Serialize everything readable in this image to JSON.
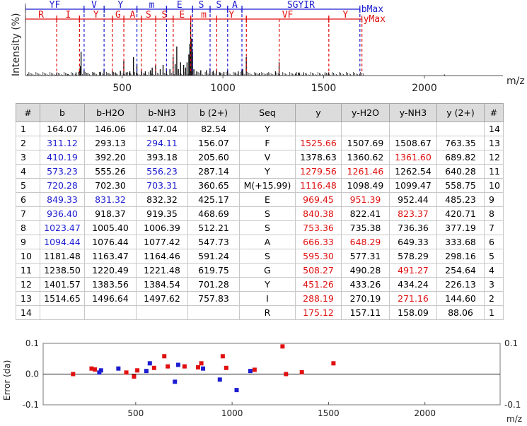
{
  "chart_data": [
    {
      "type": "bar",
      "ylabel": "Intensity (%)",
      "xlabel": "m/z",
      "xlim": [
        20,
        2390
      ],
      "xticks": [
        "500",
        "1000",
        "1500",
        "2000"
      ],
      "b_ion_ladder": {
        "end_label": "bMax",
        "color": "#1c1cd0",
        "segments": [
          {
            "label": "YF",
            "start": 20,
            "end": 311.12
          },
          {
            "label": "V",
            "start": 311.12,
            "end": 410.19
          },
          {
            "label": "Y",
            "start": 410.19,
            "end": 573.23
          },
          {
            "label": "m",
            "start": 573.23,
            "end": 720.28
          },
          {
            "label": "E",
            "start": 720.28,
            "end": 849.33
          },
          {
            "label": "S",
            "start": 849.33,
            "end": 936.4
          },
          {
            "label": "S",
            "start": 936.4,
            "end": 1023.47
          },
          {
            "label": "A",
            "start": 1023.47,
            "end": 1094.44
          },
          {
            "label": "SGYIR",
            "start": 1094.44,
            "end": 1680
          }
        ],
        "dashed_positions": [
          311.12,
          410.19,
          573.23,
          720.28,
          849.33,
          936.4,
          1023.47,
          1094.44,
          1680
        ]
      },
      "y_ion_ladder": {
        "end_label": "yMax",
        "color": "#e01010",
        "segments": [
          {
            "label": "R",
            "start": 20,
            "end": 175.12
          },
          {
            "label": "I",
            "start": 175.12,
            "end": 288.19
          },
          {
            "label": "Y",
            "start": 288.19,
            "end": 451.26
          },
          {
            "label": "G",
            "start": 451.26,
            "end": 508.27
          },
          {
            "label": "A",
            "start": 508.27,
            "end": 595.3
          },
          {
            "label": "S",
            "start": 595.3,
            "end": 666.33
          },
          {
            "label": "S",
            "start": 666.33,
            "end": 753.36
          },
          {
            "label": "E",
            "start": 753.36,
            "end": 840.38
          },
          {
            "label": "m",
            "start": 840.38,
            "end": 969.45
          },
          {
            "label": "Y",
            "start": 969.45,
            "end": 1116.48
          },
          {
            "label": "VF",
            "start": 1116.48,
            "end": 1525.66
          },
          {
            "label": "Y",
            "start": 1525.66,
            "end": 1690
          }
        ],
        "dashed_positions": [
          175.12,
          288.19,
          451.26,
          508.27,
          595.3,
          666.33,
          753.36,
          840.38,
          969.45,
          1116.48,
          1279.56,
          1525.66,
          1690
        ]
      },
      "peaks": [
        {
          "mz": 30,
          "i": 3
        },
        {
          "mz": 175,
          "i": 5
        },
        {
          "mz": 230,
          "i": 3
        },
        {
          "mz": 271,
          "i": 6
        },
        {
          "mz": 288,
          "i": 10
        },
        {
          "mz": 292,
          "i": 18
        },
        {
          "mz": 296,
          "i": 45
        },
        {
          "mz": 311,
          "i": 10
        },
        {
          "mz": 330,
          "i": 5
        },
        {
          "mz": 360,
          "i": 6
        },
        {
          "mz": 392,
          "i": 7
        },
        {
          "mz": 410,
          "i": 12
        },
        {
          "mz": 430,
          "i": 5
        },
        {
          "mz": 451,
          "i": 8
        },
        {
          "mz": 466,
          "i": 6
        },
        {
          "mz": 491,
          "i": 9
        },
        {
          "mz": 508,
          "i": 28
        },
        {
          "mz": 520,
          "i": 6
        },
        {
          "mz": 538,
          "i": 8
        },
        {
          "mz": 556,
          "i": 35
        },
        {
          "mz": 573,
          "i": 22
        },
        {
          "mz": 595,
          "i": 12
        },
        {
          "mz": 615,
          "i": 8
        },
        {
          "mz": 640,
          "i": 10
        },
        {
          "mz": 649,
          "i": 15
        },
        {
          "mz": 666,
          "i": 20
        },
        {
          "mz": 689,
          "i": 12
        },
        {
          "mz": 703,
          "i": 20
        },
        {
          "mz": 720,
          "i": 14
        },
        {
          "mz": 737,
          "i": 12
        },
        {
          "mz": 753,
          "i": 35
        },
        {
          "mz": 763,
          "i": 22
        },
        {
          "mz": 771,
          "i": 55
        },
        {
          "mz": 779,
          "i": 12
        },
        {
          "mz": 790,
          "i": 25
        },
        {
          "mz": 805,
          "i": 20
        },
        {
          "mz": 815,
          "i": 15
        },
        {
          "mz": 822,
          "i": 25
        },
        {
          "mz": 831,
          "i": 40
        },
        {
          "mz": 836,
          "i": 60
        },
        {
          "mz": 840,
          "i": 100
        },
        {
          "mz": 845,
          "i": 70
        },
        {
          "mz": 849,
          "i": 45
        },
        {
          "mz": 856,
          "i": 12
        },
        {
          "mz": 870,
          "i": 8
        },
        {
          "mz": 890,
          "i": 10
        },
        {
          "mz": 918,
          "i": 10
        },
        {
          "mz": 936,
          "i": 14
        },
        {
          "mz": 952,
          "i": 9
        },
        {
          "mz": 969,
          "i": 12
        },
        {
          "mz": 985,
          "i": 6
        },
        {
          "mz": 1005,
          "i": 7
        },
        {
          "mz": 1023,
          "i": 10
        },
        {
          "mz": 1060,
          "i": 6
        },
        {
          "mz": 1076,
          "i": 8
        },
        {
          "mz": 1094,
          "i": 10
        },
        {
          "mz": 1098,
          "i": 12
        },
        {
          "mz": 1116,
          "i": 35
        },
        {
          "mz": 1163,
          "i": 4
        },
        {
          "mz": 1181,
          "i": 5
        },
        {
          "mz": 1220,
          "i": 5
        },
        {
          "mz": 1261,
          "i": 8
        },
        {
          "mz": 1279,
          "i": 25
        },
        {
          "mz": 1360,
          "i": 4
        },
        {
          "mz": 1378,
          "i": 6
        },
        {
          "mz": 1401,
          "i": 4
        },
        {
          "mz": 1507,
          "i": 4
        },
        {
          "mz": 1525,
          "i": 6
        },
        {
          "mz": 1680,
          "i": 3
        },
        {
          "mz": 2100,
          "i": 2
        }
      ]
    },
    {
      "type": "scatter",
      "ylabel": "Error (da)",
      "xlabel": "m/z",
      "ylim": [
        -0.1,
        0.1
      ],
      "xlim": [
        20,
        2390
      ],
      "yticks_left": [
        "0.1",
        "0.0",
        "-0.1"
      ],
      "yticks_right": [
        "0.1",
        "-0.1"
      ],
      "xticks": [
        "500",
        "1000",
        "1500",
        "2000"
      ],
      "series": [
        {
          "color": "#1c1cd0",
          "points": [
            {
              "x": 311.12,
              "y": 0.005
            },
            {
              "x": 320,
              "y": 0.012
            },
            {
              "x": 410.19,
              "y": 0.018
            },
            {
              "x": 555.26,
              "y": 0.01
            },
            {
              "x": 573.23,
              "y": 0.035
            },
            {
              "x": 703.31,
              "y": -0.025
            },
            {
              "x": 720.28,
              "y": 0.03
            },
            {
              "x": 849.33,
              "y": 0.018
            },
            {
              "x": 936.4,
              "y": -0.018
            },
            {
              "x": 1023.47,
              "y": -0.052
            },
            {
              "x": 1094.44,
              "y": 0.01
            }
          ]
        },
        {
          "color": "#e01010",
          "points": [
            {
              "x": 175.12,
              "y": 0.0
            },
            {
              "x": 271.16,
              "y": 0.018
            },
            {
              "x": 288.19,
              "y": 0.015
            },
            {
              "x": 451.26,
              "y": 0.005
            },
            {
              "x": 491.27,
              "y": -0.008
            },
            {
              "x": 508.27,
              "y": 0.012
            },
            {
              "x": 595.3,
              "y": 0.02
            },
            {
              "x": 648.29,
              "y": 0.058
            },
            {
              "x": 666.33,
              "y": 0.025
            },
            {
              "x": 753.36,
              "y": 0.025
            },
            {
              "x": 823.37,
              "y": 0.022
            },
            {
              "x": 840.38,
              "y": 0.035
            },
            {
              "x": 951.39,
              "y": 0.058
            },
            {
              "x": 969.45,
              "y": 0.02
            },
            {
              "x": 1116.48,
              "y": 0.014
            },
            {
              "x": 1261.46,
              "y": 0.09
            },
            {
              "x": 1279.56,
              "y": 0.0
            },
            {
              "x": 1361.6,
              "y": 0.006
            },
            {
              "x": 1525.66,
              "y": 0.035
            }
          ]
        }
      ]
    }
  ],
  "table": {
    "headers": [
      "#",
      "b",
      "b-H2O",
      "b-NH3",
      "b (2+)",
      "Seq",
      "y",
      "y-H2O",
      "y-NH3",
      "y (2+)",
      "#"
    ],
    "colors": {
      "blue": "#1c1cd0",
      "red": "#e01010"
    },
    "rows": [
      {
        "i": "1",
        "b": "164.07",
        "bh": "146.06",
        "bn": "147.04",
        "b2": "82.54",
        "seq": "Y",
        "y": "",
        "yh": "",
        "yn": "",
        "y2": "",
        "j": "14",
        "hl": []
      },
      {
        "i": "2",
        "b": "311.12",
        "bh": "293.13",
        "bn": "294.11",
        "b2": "156.07",
        "seq": "F",
        "y": "1525.66",
        "yh": "1507.69",
        "yn": "1508.67",
        "y2": "763.35",
        "j": "13",
        "hl": [
          "b",
          "bn",
          "y"
        ]
      },
      {
        "i": "3",
        "b": "410.19",
        "bh": "392.20",
        "bn": "393.18",
        "b2": "205.60",
        "seq": "V",
        "y": "1378.63",
        "yh": "1360.62",
        "yn": "1361.60",
        "y2": "689.82",
        "j": "12",
        "hl": [
          "b",
          "yn"
        ]
      },
      {
        "i": "4",
        "b": "573.23",
        "bh": "555.26",
        "bn": "556.23",
        "b2": "287.14",
        "seq": "Y",
        "y": "1279.56",
        "yh": "1261.46",
        "yn": "1262.54",
        "y2": "640.28",
        "j": "11",
        "hl": [
          "b",
          "bn",
          "y",
          "yh"
        ]
      },
      {
        "i": "5",
        "b": "720.28",
        "bh": "702.30",
        "bn": "703.31",
        "b2": "360.65",
        "seq": "M(+15.99)",
        "y": "1116.48",
        "yh": "1098.49",
        "yn": "1099.47",
        "y2": "558.75",
        "j": "10",
        "hl": [
          "b",
          "bn",
          "y"
        ]
      },
      {
        "i": "6",
        "b": "849.33",
        "bh": "831.32",
        "bn": "832.32",
        "b2": "425.17",
        "seq": "E",
        "y": "969.45",
        "yh": "951.39",
        "yn": "952.44",
        "y2": "485.23",
        "j": "9",
        "hl": [
          "b",
          "bh",
          "y",
          "yh"
        ]
      },
      {
        "i": "7",
        "b": "936.40",
        "bh": "918.37",
        "bn": "919.35",
        "b2": "468.69",
        "seq": "S",
        "y": "840.38",
        "yh": "822.41",
        "yn": "823.37",
        "y2": "420.71",
        "j": "8",
        "hl": [
          "b",
          "y",
          "yn"
        ]
      },
      {
        "i": "8",
        "b": "1023.47",
        "bh": "1005.40",
        "bn": "1006.39",
        "b2": "512.21",
        "seq": "S",
        "y": "753.36",
        "yh": "735.38",
        "yn": "736.36",
        "y2": "377.19",
        "j": "7",
        "hl": [
          "b",
          "y"
        ]
      },
      {
        "i": "9",
        "b": "1094.44",
        "bh": "1076.44",
        "bn": "1077.42",
        "b2": "547.73",
        "seq": "A",
        "y": "666.33",
        "yh": "648.29",
        "yn": "649.33",
        "y2": "333.68",
        "j": "6",
        "hl": [
          "b",
          "y",
          "yh"
        ]
      },
      {
        "i": "10",
        "b": "1181.48",
        "bh": "1163.47",
        "bn": "1164.46",
        "b2": "591.24",
        "seq": "S",
        "y": "595.30",
        "yh": "577.31",
        "yn": "578.29",
        "y2": "298.16",
        "j": "5",
        "hl": [
          "y"
        ]
      },
      {
        "i": "11",
        "b": "1238.50",
        "bh": "1220.49",
        "bn": "1221.48",
        "b2": "619.75",
        "seq": "G",
        "y": "508.27",
        "yh": "490.28",
        "yn": "491.27",
        "y2": "254.64",
        "j": "4",
        "hl": [
          "y",
          "yn"
        ]
      },
      {
        "i": "12",
        "b": "1401.57",
        "bh": "1383.56",
        "bn": "1384.54",
        "b2": "701.28",
        "seq": "Y",
        "y": "451.26",
        "yh": "433.26",
        "yn": "434.24",
        "y2": "226.13",
        "j": "3",
        "hl": [
          "y"
        ]
      },
      {
        "i": "13",
        "b": "1514.65",
        "bh": "1496.64",
        "bn": "1497.62",
        "b2": "757.83",
        "seq": "I",
        "y": "288.19",
        "yh": "270.19",
        "yn": "271.16",
        "y2": "144.60",
        "j": "2",
        "hl": [
          "y",
          "yn"
        ]
      },
      {
        "i": "14",
        "b": "",
        "bh": "",
        "bn": "",
        "b2": "",
        "seq": "R",
        "y": "175.12",
        "yh": "157.11",
        "yn": "158.09",
        "y2": "88.06",
        "j": "1",
        "hl": [
          "y"
        ]
      }
    ]
  }
}
